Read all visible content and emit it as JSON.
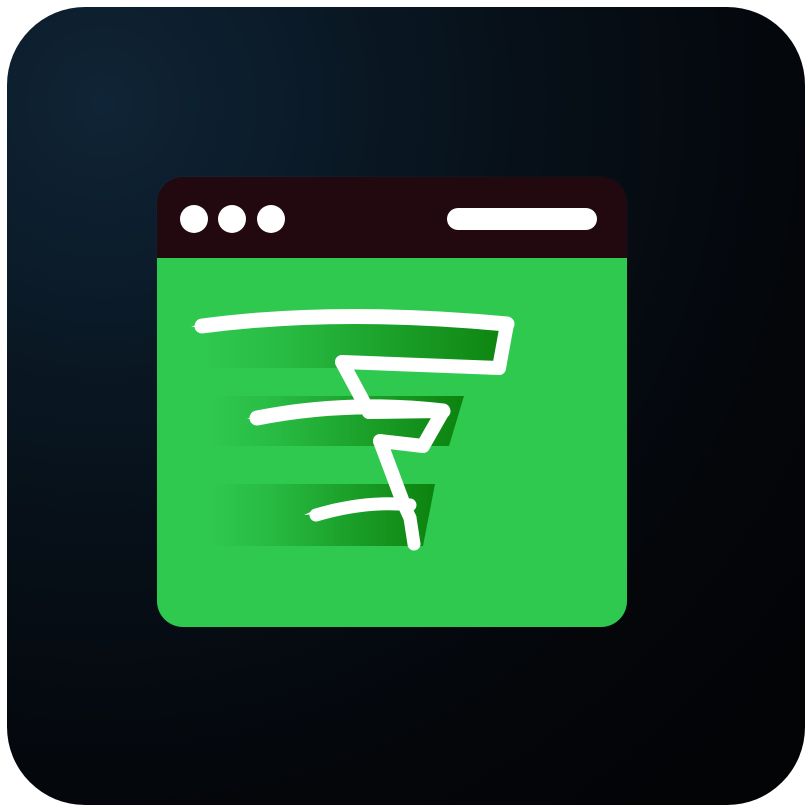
{
  "icon": {
    "name": "tornado-browser-app-icon",
    "background_colors": [
      "#0f2436",
      "#07111a",
      "#020304"
    ],
    "window_colors": {
      "titlebar": "#22090f",
      "content": "#2fc950",
      "logo_shadow": "#0b7f0b",
      "logo_stroke": "#ffffff"
    },
    "window_controls": [
      {
        "name": "window-control-dot",
        "icon": "circle"
      },
      {
        "name": "window-control-dot",
        "icon": "circle"
      },
      {
        "name": "window-control-dot",
        "icon": "circle"
      }
    ],
    "address_bar_icon": "pill",
    "logo_icon": "tornado-icon"
  }
}
